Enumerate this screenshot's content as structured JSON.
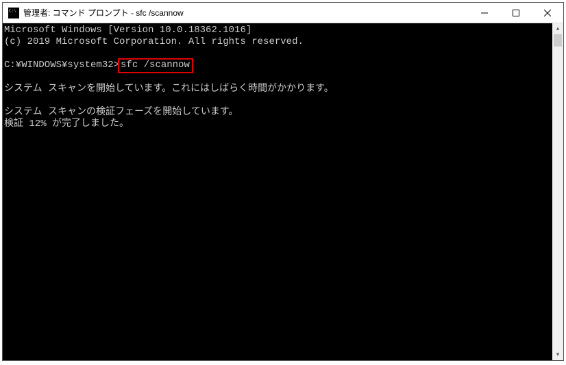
{
  "titlebar": {
    "title": "管理者: コマンド プロンプト - sfc  /scannow"
  },
  "terminal": {
    "line1": "Microsoft Windows [Version 10.0.18362.1016]",
    "line2": "(c) 2019 Microsoft Corporation. All rights reserved.",
    "prompt": "C:¥WINDOWS¥system32>",
    "command": "sfc /scannow",
    "line5": "システム スキャンを開始しています。これにはしばらく時間がかかります。",
    "line7": "システム スキャンの検証フェーズを開始しています。",
    "line8": "検証 12% が完了しました。"
  }
}
